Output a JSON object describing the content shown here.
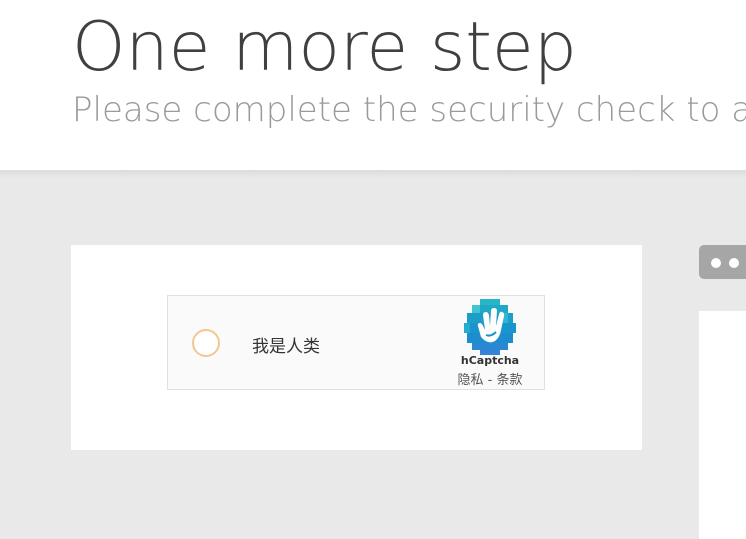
{
  "header": {
    "title": "One more step",
    "subtitle": "Please complete the security check to access"
  },
  "captcha": {
    "checkbox_label": "我是人类",
    "brand": "hCaptcha",
    "privacy_link": "隐私",
    "separator": " - ",
    "terms_link": "条款",
    "logo_icon": "hcaptcha-hand-logo",
    "checkbox_color": "#f5c693"
  },
  "side_panel": {
    "tab_icon": "dots-icon"
  }
}
